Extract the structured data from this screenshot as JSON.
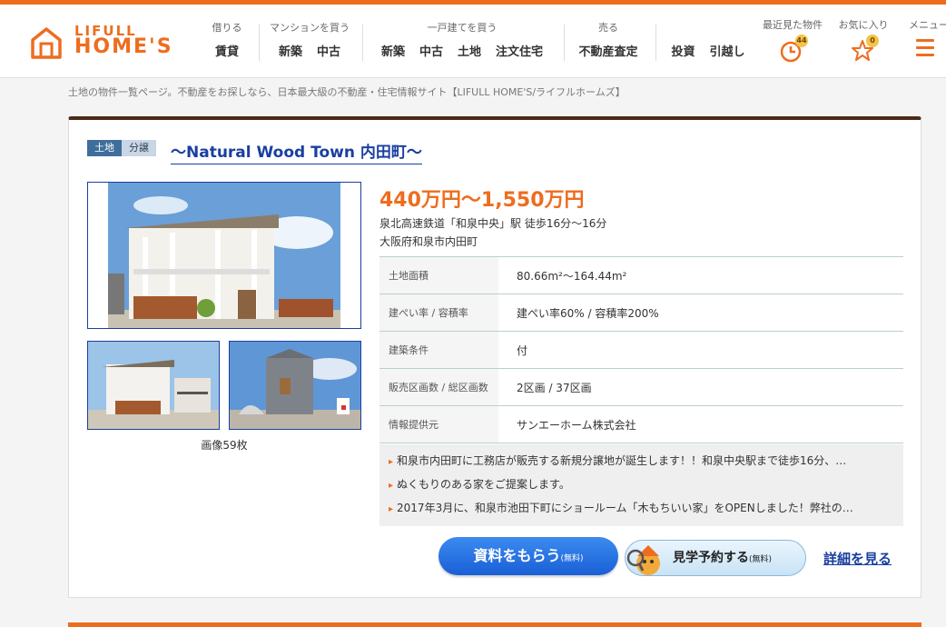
{
  "brand": {
    "line1": "LIFULL",
    "line2": "HOME'S",
    "color": "#ed6d1f"
  },
  "nav": [
    {
      "category": "借りる",
      "items": [
        "賃貸"
      ]
    },
    {
      "category": "マンションを買う",
      "items": [
        "新築",
        "中古"
      ]
    },
    {
      "category": "一戸建てを買う",
      "items": [
        "新築",
        "中古",
        "土地",
        "注文住宅"
      ]
    },
    {
      "category": "売る",
      "items": [
        "不動産査定"
      ]
    },
    {
      "category": "",
      "items": [
        "投資",
        "引越し"
      ]
    }
  ],
  "utility": {
    "recent": {
      "label": "最近見た物件",
      "count": "44",
      "icon": "clock-icon"
    },
    "favorites": {
      "label": "お気に入り",
      "count": "0",
      "icon": "star-icon"
    },
    "menu": {
      "label": "メニュー",
      "icon": "hamburger-icon"
    }
  },
  "breadcrumb": "土地の物件一覧ページ。不動産をお探しなら、日本最大級の不動産・住宅情報サイト【LIFULL HOME'S/ライフルホームズ】",
  "listing": {
    "tags": [
      "土地",
      "分譲"
    ],
    "title": "～Natural Wood Town 内田町～",
    "image_count": "画像59枚",
    "price": "440万円～1,550万円",
    "access": "泉北高速鉄道「和泉中央」駅 徒歩16分～16分",
    "address": "大阪府和泉市内田町",
    "specs": [
      {
        "label": "土地面積",
        "value": "80.66m²～164.44m²"
      },
      {
        "label": "建ぺい率 / 容積率",
        "value": "建ぺい率60% / 容積率200%"
      },
      {
        "label": "建築条件",
        "value": "付"
      },
      {
        "label": "販売区画数 / 総区画数",
        "value": "2区画 / 37区画"
      },
      {
        "label": "情報提供元",
        "value": "サンエーホーム株式会社"
      }
    ],
    "features": [
      "和泉市内田町に工務店が販売する新規分譲地が誕生します！！和泉中央駅まで徒歩16分、…",
      "ぬくもりのある家をご提案します。",
      "2017年3月に、和泉市池田下町にショールーム「木もちいい家」をOPENしました！弊社の…"
    ],
    "buttons": {
      "request": "資料をもらう",
      "request_note": "(無料)",
      "visit": "見学予約する",
      "visit_note": "(無料)",
      "details": "詳細を見る"
    }
  }
}
